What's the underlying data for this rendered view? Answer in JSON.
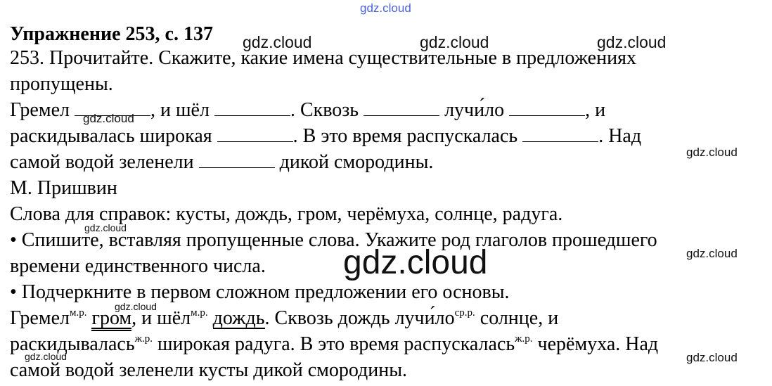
{
  "title": "Упражнение 253, с. 137",
  "intro": {
    "line1": "253. Прочитайте. Скажите, какие имена существительные в предложениях",
    "line2": "пропущены."
  },
  "task_text": {
    "l1": [
      "Гремел ",
      ", и шёл ",
      ". Сквозь ",
      " лучи́ло ",
      ", и"
    ],
    "l2": [
      "раскидывалась широкая ",
      ". В это время распускалась ",
      ". Над"
    ],
    "l3": [
      "самой водой зеленели ",
      " дикой смородины."
    ]
  },
  "author": "М. Пришвин",
  "hint": "Слова для справок: кусты, дождь, гром, черёмуха, солнце, радуга.",
  "instruction1": {
    "line1": "• Спишите, вставляя пропущенные слова. Укажите род глаголов прошедшего",
    "line2": "времени единственного числа."
  },
  "instruction2": "• Подчеркните в первом сложном предложении его основы.",
  "answer": {
    "l1": {
      "w1": "Гремел",
      "s1": "м.р.",
      "w2": "гром",
      "w3": ", и шёл",
      "s2": "м.р.",
      "w4": "дождь",
      "w5": ". Сквозь дождь лучи́ло",
      "s3": "ср.р.",
      "w6": " солнце, и"
    },
    "l2": {
      "w1": "раскидывалась",
      "s1": "ж.р.",
      "w2": " широкая радуга. В это время распускалась",
      "s2": "ж.р.",
      "w3": " черёмуха. Над"
    },
    "l3": "самой водой зеленели кусты дикой смородины."
  },
  "watermark": "gdz.cloud"
}
